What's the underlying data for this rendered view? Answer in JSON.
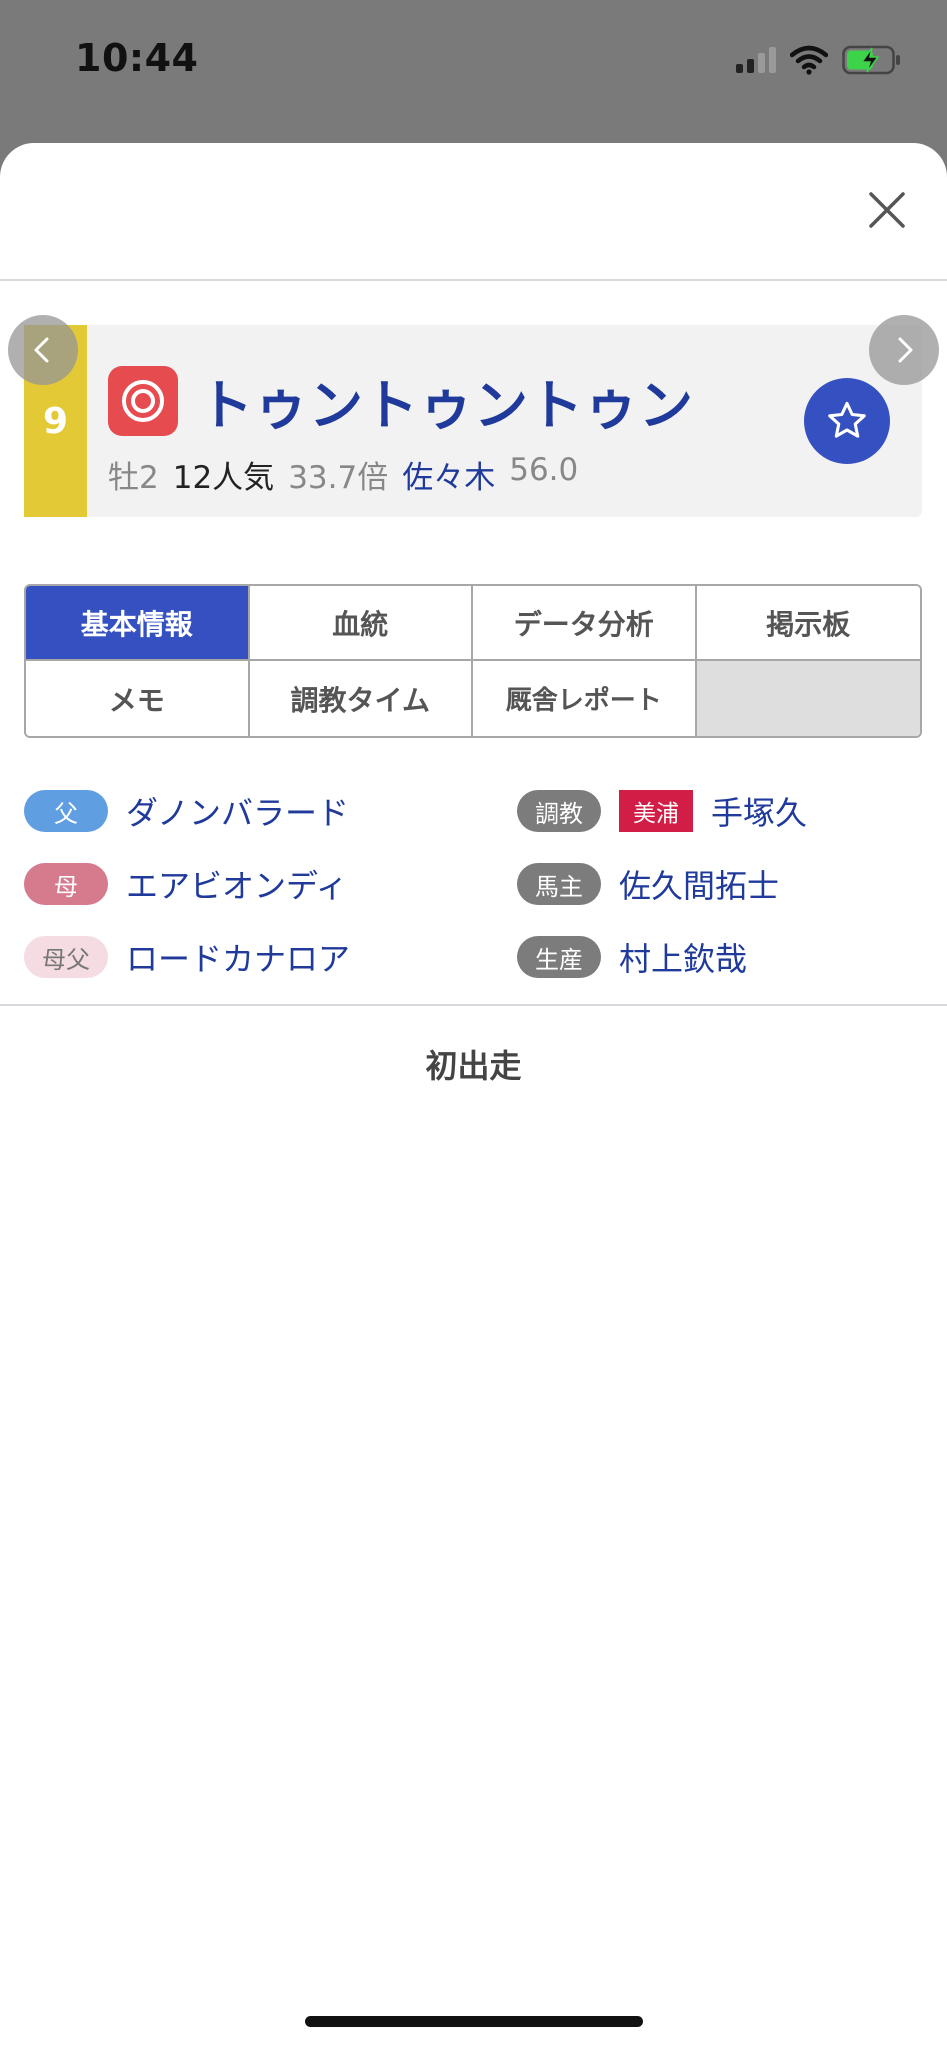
{
  "status_bar": {
    "time": "10:44",
    "signal_icon": "signal-icon",
    "wifi_icon": "wifi-icon",
    "battery_icon": "battery-charging-icon"
  },
  "modal": {
    "close_icon": "close-icon"
  },
  "horse": {
    "gate_number": "9",
    "mark_icon": "double-circle-mark-icon",
    "name": "トゥントゥントゥン",
    "sex_age": "牡2",
    "popularity": "12人気",
    "odds": "33.7倍",
    "jockey": "佐々木",
    "weight": "56.0",
    "favorite_icon": "star-icon"
  },
  "nav": {
    "prev_icon": "chevron-left-icon",
    "next_icon": "chevron-right-icon"
  },
  "tabs": [
    "基本情報",
    "血統",
    "データ分析",
    "掲示板",
    "メモ",
    "調教タイム",
    "厩舎レポート"
  ],
  "active_tab": "基本情報",
  "pedigree": {
    "sire_label": "父",
    "sire": "ダノンバラード",
    "dam_label": "母",
    "dam": "エアビオンディ",
    "damsire_label": "母父",
    "damsire": "ロードカナロア"
  },
  "connections": {
    "trainer_label": "調教",
    "trainer_region": "美浦",
    "trainer": "手塚久",
    "owner_label": "馬主",
    "owner": "佐久間拓士",
    "breeder_label": "生産",
    "breeder": "村上欽哉"
  },
  "race_history": {
    "message": "初出走"
  },
  "colors": {
    "accent_blue": "#3550c0",
    "link_blue": "#1f3a9a",
    "gate_yellow": "#e4c936",
    "mark_red": "#e54b4f",
    "region_red": "#d21d47",
    "sire_blue": "#5f9ee0",
    "dam_pink": "#d67a8e",
    "damsire_pink": "#f5dce2"
  }
}
